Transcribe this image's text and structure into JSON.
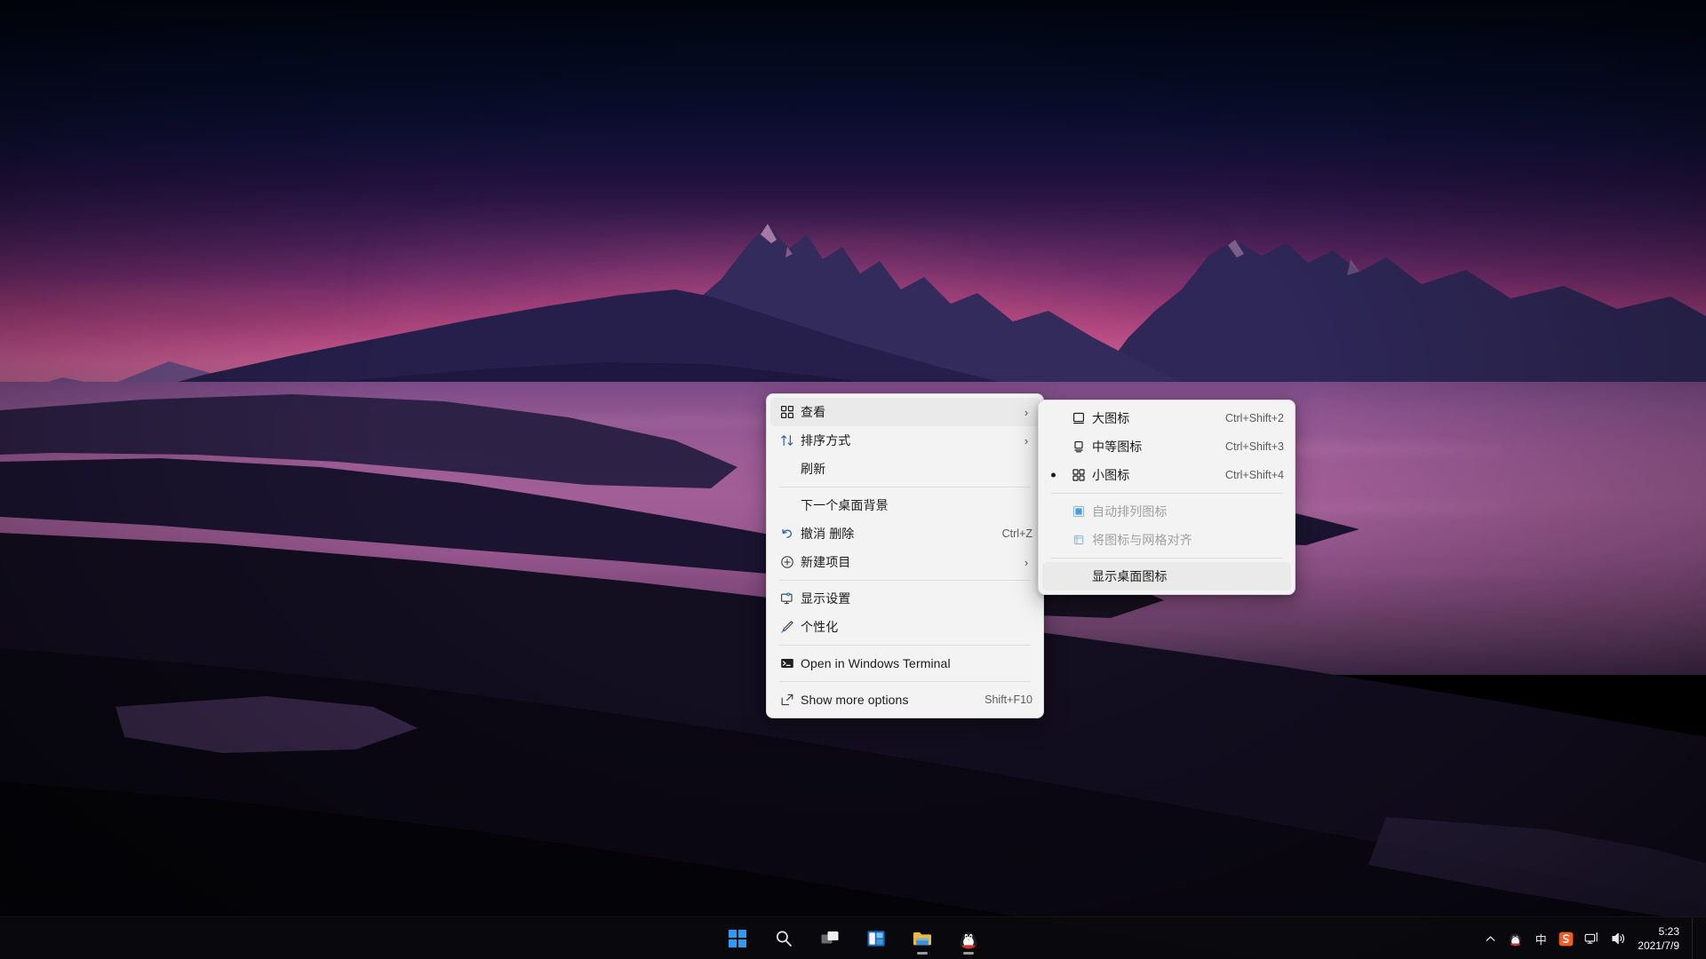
{
  "desktop": {
    "wallpaper_name": "mountain-lake-sunset-wallpaper",
    "colors": {
      "sky_top": "#01040f",
      "sky_mid": "#4d2159",
      "sky_glow": "#c35d90",
      "water": "#a25f97",
      "mountain": "#2b2450",
      "taskbar": "#0a0a0e",
      "menu_bg": "#f3f3f3",
      "menu_text": "#1b1b1b",
      "accent_blue": "#0078d4"
    }
  },
  "context_menu": {
    "name": "desktop-context-menu",
    "items": [
      {
        "id": "view",
        "label": "查看",
        "icon": "grid-icon",
        "accel": "",
        "submenu": true,
        "separator_after": false,
        "highlighted": true,
        "disabled": false
      },
      {
        "id": "sort-by",
        "label": "排序方式",
        "icon": "sort-icon",
        "accel": "",
        "submenu": true,
        "separator_after": false,
        "highlighted": false,
        "disabled": false
      },
      {
        "id": "refresh",
        "label": "刷新",
        "icon": "none",
        "accel": "",
        "submenu": false,
        "separator_after": true,
        "highlighted": false,
        "disabled": false
      },
      {
        "id": "next-desktop-background",
        "label": "下一个桌面背景",
        "icon": "none",
        "accel": "",
        "submenu": false,
        "separator_after": false,
        "highlighted": false,
        "disabled": false
      },
      {
        "id": "undo-delete",
        "label": "撤消 删除",
        "icon": "undo-icon",
        "accel": "Ctrl+Z",
        "submenu": false,
        "separator_after": false,
        "highlighted": false,
        "disabled": false
      },
      {
        "id": "new-item",
        "label": "新建项目",
        "icon": "plus-circle-icon",
        "accel": "",
        "submenu": true,
        "separator_after": true,
        "highlighted": false,
        "disabled": false
      },
      {
        "id": "display-settings",
        "label": "显示设置",
        "icon": "monitor-icon",
        "accel": "",
        "submenu": false,
        "separator_after": false,
        "highlighted": false,
        "disabled": false
      },
      {
        "id": "personalize",
        "label": "个性化",
        "icon": "brush-icon",
        "accel": "",
        "submenu": false,
        "separator_after": true,
        "highlighted": false,
        "disabled": false
      },
      {
        "id": "open-in-windows-terminal",
        "label": "Open in Windows Terminal",
        "icon": "terminal-icon",
        "accel": "",
        "submenu": false,
        "separator_after": true,
        "highlighted": false,
        "disabled": false
      },
      {
        "id": "show-more-options",
        "label": "Show more options",
        "icon": "more-options-icon",
        "accel": "Shift+F10",
        "submenu": false,
        "separator_after": false,
        "highlighted": false,
        "disabled": false
      }
    ]
  },
  "view_submenu": {
    "name": "view-submenu",
    "items": [
      {
        "id": "large-icons",
        "label": "大图标",
        "icon": "large-icon-glyph",
        "accel": "Ctrl+Shift+2",
        "selected": false,
        "disabled": false,
        "separator_after": false,
        "highlighted": false
      },
      {
        "id": "medium-icons",
        "label": "中等图标",
        "icon": "medium-icon-glyph",
        "accel": "Ctrl+Shift+3",
        "selected": false,
        "disabled": false,
        "separator_after": false,
        "highlighted": false
      },
      {
        "id": "small-icons",
        "label": "小图标",
        "icon": "small-icon-glyph",
        "accel": "Ctrl+Shift+4",
        "selected": true,
        "disabled": false,
        "separator_after": true,
        "highlighted": false
      },
      {
        "id": "auto-arrange",
        "label": "自动排列图标",
        "icon": "auto-arrange-icon",
        "accel": "",
        "selected": false,
        "disabled": true,
        "separator_after": false,
        "highlighted": false
      },
      {
        "id": "align-to-grid",
        "label": "将图标与网格对齐",
        "icon": "align-grid-icon",
        "accel": "",
        "selected": false,
        "disabled": true,
        "separator_after": true,
        "highlighted": false
      },
      {
        "id": "show-desktop-icons",
        "label": "显示桌面图标",
        "icon": "none",
        "accel": "",
        "selected": false,
        "disabled": false,
        "separator_after": false,
        "highlighted": true
      }
    ]
  },
  "taskbar": {
    "buttons": [
      {
        "id": "start",
        "icon": "windows-start-icon",
        "label": "开始",
        "running": false
      },
      {
        "id": "search",
        "icon": "search-icon",
        "label": "搜索",
        "running": false
      },
      {
        "id": "task-view",
        "icon": "task-view-icon",
        "label": "任务视图",
        "running": false
      },
      {
        "id": "widgets",
        "icon": "widgets-icon",
        "label": "小组件",
        "running": false
      },
      {
        "id": "file-explorer",
        "icon": "folder-icon",
        "label": "文件资源管理器",
        "running": true
      },
      {
        "id": "qq",
        "icon": "qq-penguin-icon",
        "label": "QQ",
        "running": true
      }
    ],
    "tray": [
      {
        "id": "tray-expand",
        "icon": "chevron-up-icon",
        "label": "显示隐藏的图标"
      },
      {
        "id": "tray-qq",
        "icon": "qq-penguin-icon",
        "label": "QQ"
      },
      {
        "id": "tray-ime",
        "icon": "ime-icon",
        "label": "中"
      },
      {
        "id": "tray-sogou",
        "icon": "sogou-icon",
        "label": "S"
      },
      {
        "id": "tray-network",
        "icon": "network-icon",
        "label": "网络"
      },
      {
        "id": "tray-volume",
        "icon": "volume-icon",
        "label": "音量"
      }
    ],
    "clock": {
      "time": "5:23",
      "date": "2021/7/9"
    }
  }
}
